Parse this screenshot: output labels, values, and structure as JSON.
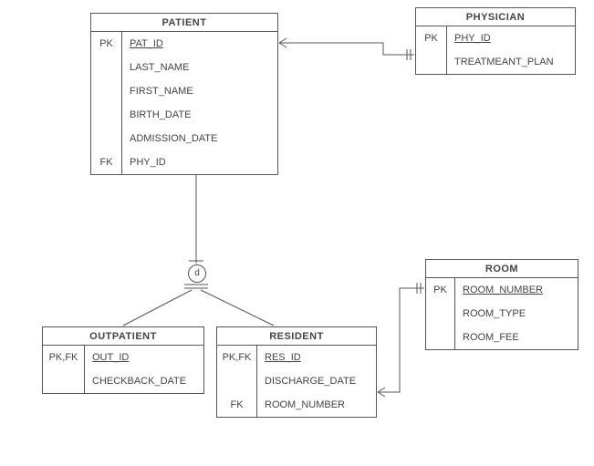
{
  "entities": {
    "patient": {
      "title": "PATIENT",
      "keys": [
        "PK",
        "",
        "",
        "",
        "",
        "FK"
      ],
      "attrs": [
        "PAT_ID",
        "LAST_NAME",
        "FIRST_NAME",
        "BIRTH_DATE",
        "ADMISSION_DATE",
        "PHY_ID"
      ],
      "pk_underline": [
        true,
        false,
        false,
        false,
        false,
        false
      ]
    },
    "physician": {
      "title": "PHYSICIAN",
      "keys": [
        "PK",
        ""
      ],
      "attrs": [
        "PHY_ID",
        "TREATMEANT_PLAN"
      ],
      "pk_underline": [
        true,
        false
      ]
    },
    "outpatient": {
      "title": "OUTPATIENT",
      "keys": [
        "PK,FK",
        ""
      ],
      "attrs": [
        "OUT_ID",
        "CHECKBACK_DATE"
      ],
      "pk_underline": [
        true,
        false
      ]
    },
    "resident": {
      "title": "RESIDENT",
      "keys": [
        "PK,FK",
        "",
        "FK"
      ],
      "attrs": [
        "RES_ID",
        "DISCHARGE_DATE",
        "ROOM_NUMBER"
      ],
      "pk_underline": [
        true,
        false,
        false
      ]
    },
    "room": {
      "title": "ROOM",
      "keys": [
        "PK",
        "",
        ""
      ],
      "attrs": [
        "ROOM_NUMBER",
        "ROOM_TYPE",
        "ROOM_FEE"
      ],
      "pk_underline": [
        true,
        false,
        false
      ]
    }
  },
  "disjoint_symbol": "d",
  "connectors": [
    {
      "from": "PATIENT.PHY_ID",
      "to": "PHYSICIAN.PHY_ID",
      "child_side": "PATIENT",
      "notation": "crow-foot / double-bar"
    },
    {
      "from": "PATIENT",
      "to": "OUTPATIENT",
      "kind": "isa"
    },
    {
      "from": "PATIENT",
      "to": "RESIDENT",
      "kind": "isa"
    },
    {
      "from": "RESIDENT.ROOM_NUMBER",
      "to": "ROOM.ROOM_NUMBER",
      "child_side": "RESIDENT",
      "notation": "crow-foot / double-bar"
    }
  ]
}
